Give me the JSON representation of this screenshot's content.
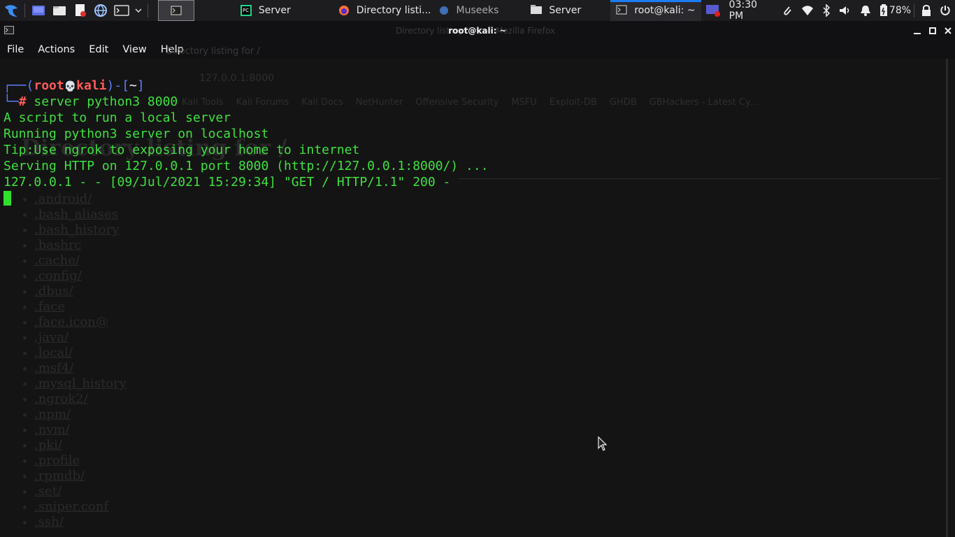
{
  "taskbar": {
    "tasks": [
      {
        "label": "Server",
        "icon": "pycharm-icon"
      },
      {
        "label": "Directory listi...",
        "icon": "firefox-icon"
      },
      {
        "label": "Museeks",
        "icon": "museeks-icon"
      },
      {
        "label": "Server",
        "icon": "folder-icon"
      },
      {
        "label": "root@kali: ~",
        "icon": "terminal-icon",
        "active": true
      }
    ],
    "clock": "03:30 PM",
    "battery": "78%"
  },
  "window": {
    "title": "root@kali: ~",
    "ghost_title": "Directory listing for / — Mozilla Firefox"
  },
  "menu": {
    "file": "File",
    "actions": "Actions",
    "edit": "Edit",
    "view": "View",
    "help": "Help"
  },
  "terminal": {
    "prompt": {
      "open_bracket": "┌──(",
      "user": "root",
      "skull": "💀",
      "host": "kali",
      "mid": ")-[",
      "dir": "~",
      "close": "]",
      "corner": "└─",
      "hash": "#"
    },
    "command": " server python3 8000",
    "output": [
      "A script to run a local server",
      "Running python3 server on localhost",
      "Tip:Use ngrok to exposing your home to internet",
      "Serving HTTP on 127.0.0.1 port 8000 (http://127.0.0.1:8000/) ...",
      "127.0.0.1 - - [09/Jul/2021 15:29:34] \"GET / HTTP/1.1\" 200 -"
    ]
  },
  "background_browser": {
    "tab_label": "Directory listing for /",
    "url": "127.0.0.1:8000",
    "bookmarks": [
      "Kali Tools",
      "Kali Forums",
      "Kali Docs",
      "NetHunter",
      "Offensive Security",
      "MSFU",
      "Exploit-DB",
      "GHDB",
      "GBHackers - Latest Cy..."
    ],
    "heading": "Directory listing for /",
    "entries": [
      ".android/",
      ".bash_aliases",
      ".bash_history",
      ".bashrc",
      ".cache/",
      ".config/",
      ".dbus/",
      ".face",
      ".face.icon@",
      ".java/",
      ".local/",
      ".msf4/",
      ".mysql_history",
      ".ngrok2/",
      ".npm/",
      ".nvm/",
      ".pki/",
      ".profile",
      ".rpmdb/",
      ".set/",
      ".sniper.conf",
      ".ssh/"
    ]
  },
  "colors": {
    "terminal_green": "#3fe03f",
    "prompt_blue": "#5c7cff",
    "prompt_red": "#ff5b5b",
    "active_task_accent": "#1c7cf2"
  }
}
